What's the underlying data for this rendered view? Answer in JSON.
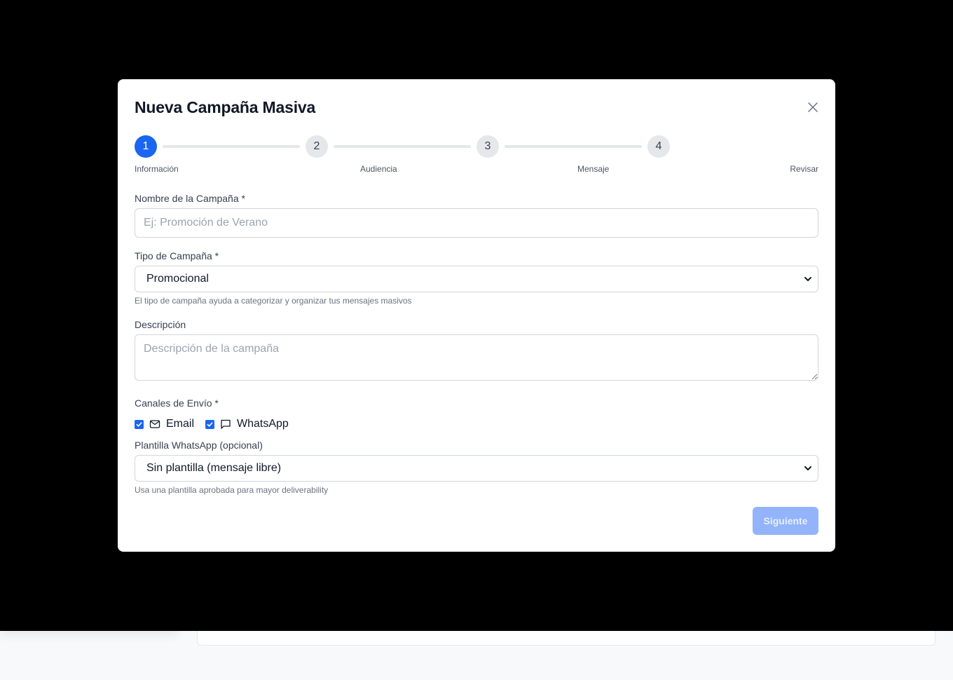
{
  "modal": {
    "title": "Nueva Campaña Masiva"
  },
  "stepper": {
    "steps": [
      {
        "number": "1",
        "label": "Información",
        "active": true
      },
      {
        "number": "2",
        "label": "Audiencia",
        "active": false
      },
      {
        "number": "3",
        "label": "Mensaje",
        "active": false
      },
      {
        "number": "4",
        "label": "Revisar",
        "active": false
      }
    ]
  },
  "form": {
    "name_label": "Nombre de la Campaña *",
    "name_placeholder": "Ej: Promoción de Verano",
    "name_value": "",
    "type_label": "Tipo de Campaña *",
    "type_value": "Promocional",
    "type_help": "El tipo de campaña ayuda a categorizar y organizar tus mensajes masivos",
    "description_label": "Descripción",
    "description_placeholder": "Descripción de la campaña",
    "channels_label": "Canales de Envío *",
    "channels": [
      {
        "label": "Email",
        "checked": true,
        "icon": "mail-icon"
      },
      {
        "label": "WhatsApp",
        "checked": true,
        "icon": "message-square-icon"
      }
    ],
    "template_label": "Plantilla WhatsApp (opcional)",
    "template_value": "Sin plantilla (mensaje libre)",
    "template_help": "Usa una plantilla aprobada para mayor deliverability"
  },
  "actions": {
    "next_label": "Siguiente"
  },
  "colors": {
    "accent": "#1a66f0",
    "accent_disabled": "#93b4fb",
    "overlay": "#000000"
  }
}
